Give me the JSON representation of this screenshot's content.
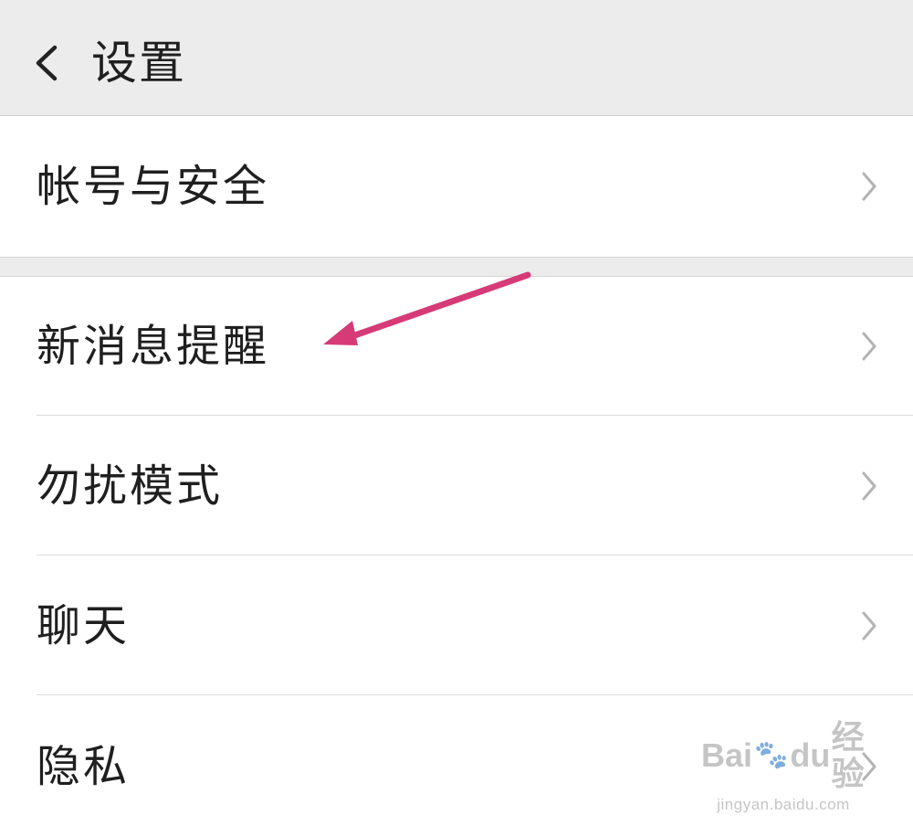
{
  "header": {
    "title": "设置",
    "back_icon": "chevron-left-icon"
  },
  "settings": {
    "items": [
      {
        "label": "帐号与安全",
        "icon": "chevron-right-icon"
      },
      {
        "label": "新消息提醒",
        "icon": "chevron-right-icon"
      },
      {
        "label": "勿扰模式",
        "icon": "chevron-right-icon"
      },
      {
        "label": "聊天",
        "icon": "chevron-right-icon"
      },
      {
        "label": "隐私",
        "icon": "chevron-right-icon"
      }
    ]
  },
  "annotation": {
    "arrow_color": "#d63b78"
  },
  "watermark": {
    "logo_text_a": "Bai",
    "logo_text_b": "du",
    "logo_text_c": "经验",
    "url": "jingyan.baidu.com"
  }
}
